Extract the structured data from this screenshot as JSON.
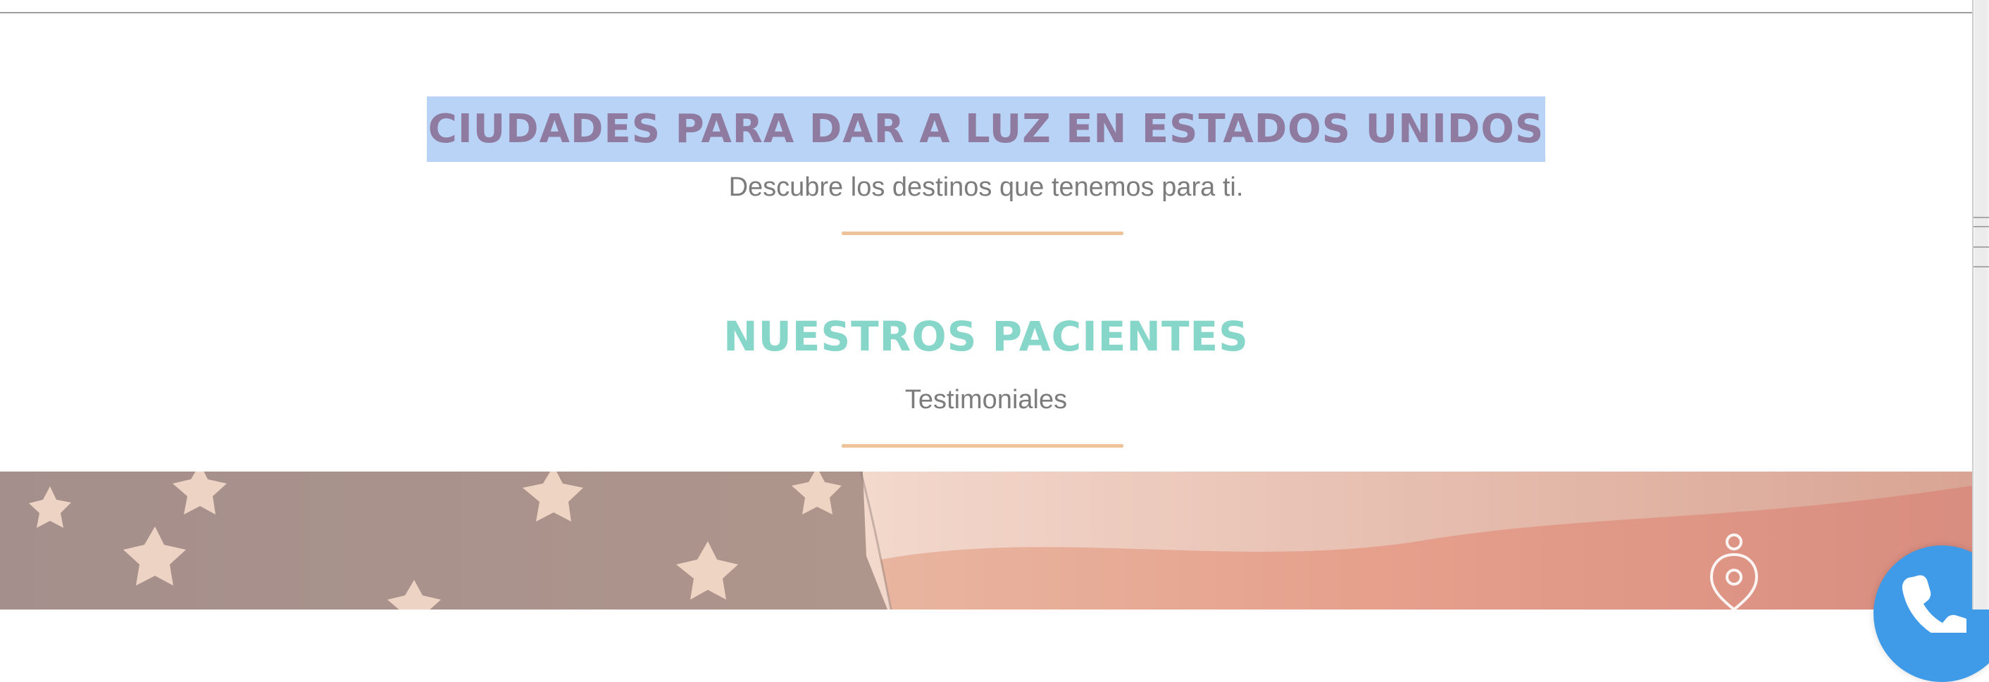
{
  "sections": {
    "cities": {
      "title": "CIUDADES PARA DAR A LUZ EN ESTADOS UNIDOS",
      "subtitle": "Descubre los destinos que tenemos para ti."
    },
    "patients": {
      "title": "NUESTROS PACIENTES",
      "subtitle": "Testimoniales"
    }
  },
  "colors": {
    "title_primary": "#8f7b9f",
    "title_secondary": "#87d6ca",
    "divider": "#eec39a",
    "selection_highlight": "#b9d3f7",
    "call_button": "#3f9ae8"
  },
  "icons": {
    "hero_location": "map-pin-icon",
    "call": "phone-icon"
  }
}
